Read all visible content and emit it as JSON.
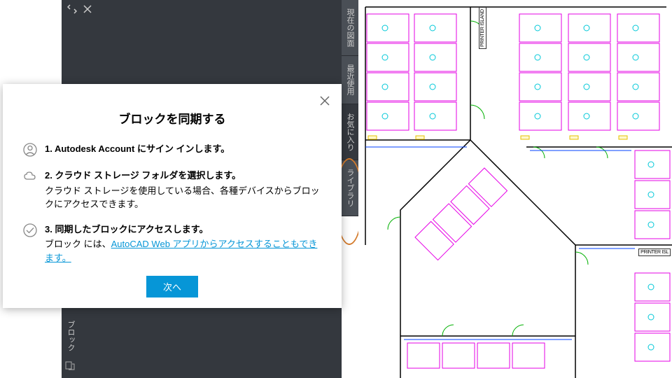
{
  "panel_label": "ブロック",
  "side_tabs": [
    {
      "id": "current",
      "label": "現在の図面"
    },
    {
      "id": "recent",
      "label": "最近使用"
    },
    {
      "id": "favorites",
      "label": "お気に入り"
    },
    {
      "id": "library",
      "label": "ライブラリ"
    }
  ],
  "dialog": {
    "title": "ブロックを同期する",
    "step1_title": "1. Autodesk Account にサイン インします。",
    "step2_title": "2. クラウド ストレージ フォルダを選択します。",
    "step2_desc": "クラウド ストレージを使用している場合、各種デバイスからブロックにアクセスできます。",
    "step3_title": "3. 同期したブロックにアクセスします。",
    "step3_desc_pre": "ブロック には、",
    "step3_link": "AutoCAD Web アプリからアクセスすることもできます。",
    "next_btn": "次へ"
  },
  "drawing": {
    "printer_island": "PRINTER ISLAND",
    "printer_isl_short": "PRINTER ISL"
  }
}
